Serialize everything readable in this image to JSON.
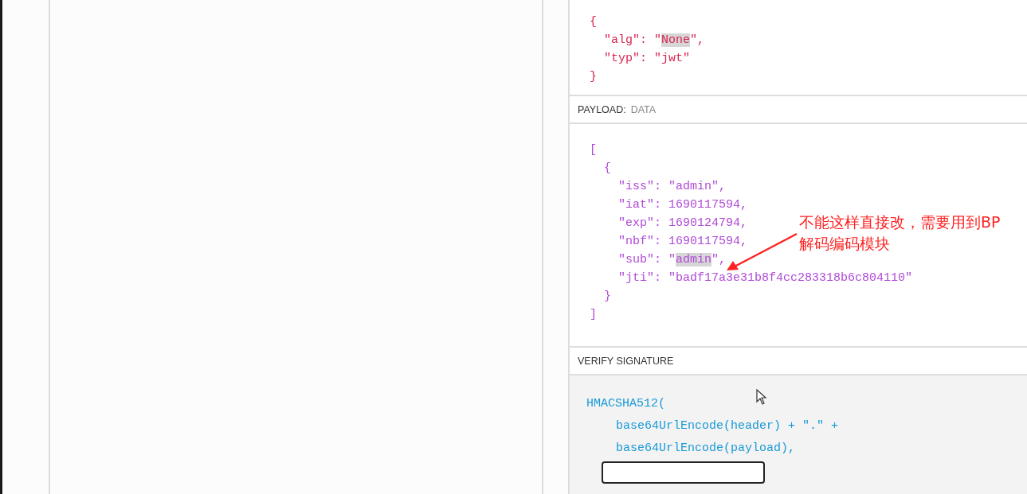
{
  "header_code": [
    {
      "text": "{"
    },
    {
      "text": "  \"alg\": \"",
      "selection": "None",
      "rest": "\","
    },
    {
      "text": "  \"typ\": \"jwt\""
    },
    {
      "text": "}"
    }
  ],
  "payload": {
    "label": "PAYLOAD:",
    "sublabel": "DATA",
    "code": [
      {
        "text": "["
      },
      {
        "text": "  {"
      },
      {
        "text": "    \"iss\": \"admin\","
      },
      {
        "text": "    \"iat\": 1690117594,"
      },
      {
        "text": "    \"exp\": 1690124794,"
      },
      {
        "text": "    \"nbf\": 1690117594,"
      },
      {
        "text": "    \"sub\": \"",
        "selection": "admin",
        "rest": "\","
      },
      {
        "text": "    \"jti\": \"badf17a3e31b8f4cc283318b6c804110\""
      },
      {
        "text": "  }"
      },
      {
        "text": "]"
      }
    ]
  },
  "signature": {
    "label": "VERIFY SIGNATURE",
    "code": [
      {
        "text": "HMACSHA512("
      },
      {
        "text": "  base64UrlEncode(header) + \".\" +"
      },
      {
        "text": "  base64UrlEncode(payload),"
      }
    ],
    "secret_field": {
      "kind": "text"
    }
  },
  "annotation": {
    "text": "不能这样直接改，需要用到BP\n解码编码模块"
  }
}
